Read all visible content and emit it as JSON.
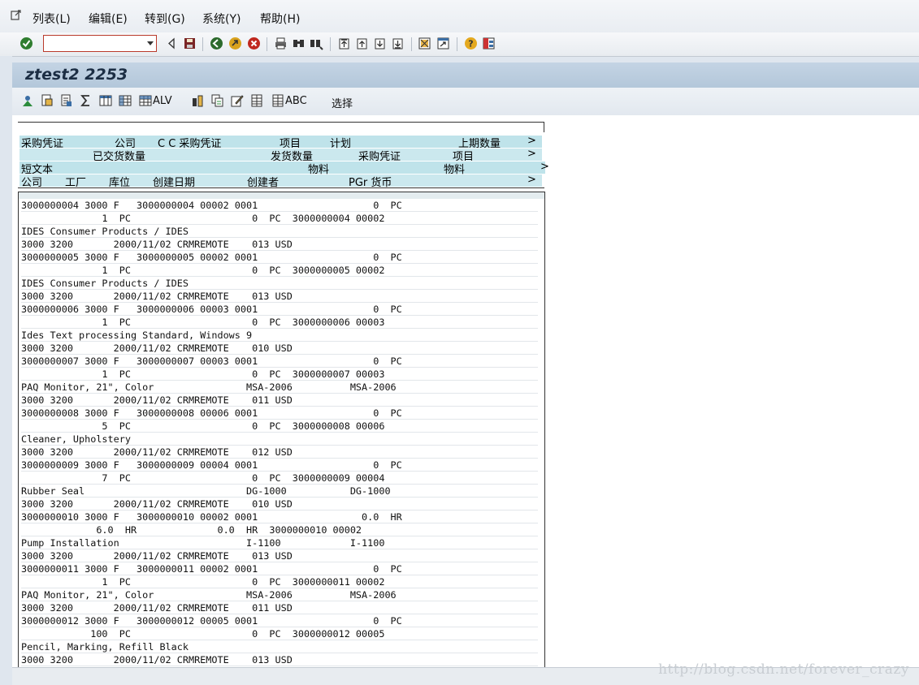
{
  "menu": {
    "items": [
      "列表(L)",
      "编辑(E)",
      "转到(G)",
      "系统(Y)",
      "帮助(H)"
    ]
  },
  "toolbar": {
    "command_value": ""
  },
  "title": "ztest2 2253",
  "app_toolbar": {
    "alv_label": "ALV",
    "abc_label": "ABC",
    "select_label": "选择"
  },
  "header": {
    "row1": [
      {
        "text": "采购凭证"
      },
      {
        "text": "公司"
      },
      {
        "text": "C C 采购凭证"
      },
      {
        "text": "项目"
      },
      {
        "text": "计划"
      },
      {
        "text": "上期数量"
      },
      {
        "text": ">"
      }
    ],
    "row2": [
      {
        "text": "已交货数量"
      },
      {
        "text": "发货数量"
      },
      {
        "text": "采购凭证"
      },
      {
        "text": "项目"
      },
      {
        "text": ">"
      }
    ],
    "row3": [
      {
        "text": "短文本"
      },
      {
        "text": "物料"
      },
      {
        "text": "物料"
      },
      {
        "text": ">"
      }
    ],
    "row4": [
      {
        "text": "公司"
      },
      {
        "text": "工厂"
      },
      {
        "text": "库位"
      },
      {
        "text": "创建日期"
      },
      {
        "text": "创建者"
      },
      {
        "text": "PGr 货币"
      },
      {
        "text": ">"
      }
    ]
  },
  "lines": [
    "3000000004 3000 F   3000000004 00002 0001                    0  PC",
    "              1  PC                     0  PC  3000000004 00002",
    "IDES Consumer Products / IDES",
    "3000 3200       2000/11/02 CRMREMOTE    013 USD",
    "3000000005 3000 F   3000000005 00002 0001                    0  PC",
    "              1  PC                     0  PC  3000000005 00002",
    "IDES Consumer Products / IDES",
    "3000 3200       2000/11/02 CRMREMOTE    013 USD",
    "3000000006 3000 F   3000000006 00003 0001                    0  PC",
    "              1  PC                     0  PC  3000000006 00003",
    "Ides Text processing Standard, Windows 9",
    "3000 3200       2000/11/02 CRMREMOTE    010 USD",
    "3000000007 3000 F   3000000007 00003 0001                    0  PC",
    "              1  PC                     0  PC  3000000007 00003",
    "PAQ Monitor, 21\", Color                MSA-2006          MSA-2006",
    "3000 3200       2000/11/02 CRMREMOTE    011 USD",
    "3000000008 3000 F   3000000008 00006 0001                    0  PC",
    "              5  PC                     0  PC  3000000008 00006",
    "Cleaner, Upholstery",
    "3000 3200       2000/11/02 CRMREMOTE    012 USD",
    "3000000009 3000 F   3000000009 00004 0001                    0  PC",
    "              7  PC                     0  PC  3000000009 00004",
    "Rubber Seal                            DG-1000           DG-1000",
    "3000 3200       2000/11/02 CRMREMOTE    010 USD",
    "3000000010 3000 F   3000000010 00002 0001                  0.0  HR",
    "             6.0  HR              0.0  HR  3000000010 00002",
    "Pump Installation                      I-1100            I-1100",
    "3000 3200       2000/11/02 CRMREMOTE    013 USD",
    "3000000011 3000 F   3000000011 00002 0001                    0  PC",
    "              1  PC                     0  PC  3000000011 00002",
    "PAQ Monitor, 21\", Color                MSA-2006          MSA-2006",
    "3000 3200       2000/11/02 CRMREMOTE    011 USD",
    "3000000012 3000 F   3000000012 00005 0001                    0  PC",
    "            100  PC                     0  PC  3000000012 00005",
    "Pencil, Marking, Refill Black",
    "3000 3200       2000/11/02 CRMREMOTE    013 USD"
  ],
  "watermark": "http://blog.csdn.net/forever_crazy"
}
